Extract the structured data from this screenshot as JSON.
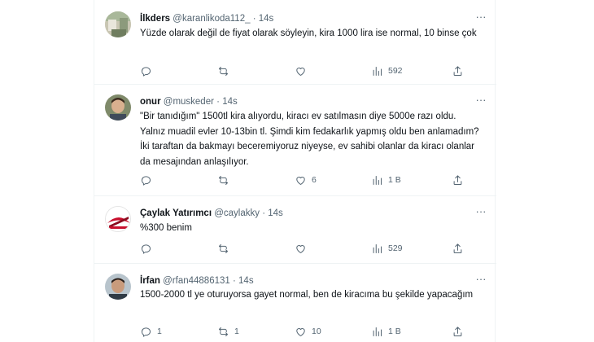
{
  "tweets": [
    {
      "name": "İlkders",
      "handle": "@karanlikoda112_",
      "dot": "·",
      "time": "14s",
      "text": "Yüzde olarak değil de fiyat olarak söyleyin, kira 1000 lira ise normal, 10 binse çok",
      "replies": "",
      "retweets": "",
      "likes": "",
      "views": "592",
      "avatar": "photo-ilkders"
    },
    {
      "name": "onur",
      "handle": "@muskeder",
      "dot": "·",
      "time": "14s",
      "text": "\"Bir tanıdığım\" 1500tl kira alıyordu, kiracı ev satılmasın diye 5000e razı oldu. Yalnız muadil evler 10-13bin tl. Şimdi kim fedakarlık yapmış oldu ben anlamadım? İki taraftan da bakmayı beceremiyoruz niyeyse, ev sahibi olanlar da kiracı olanlar da mesajından anlaşılıyor.",
      "replies": "",
      "retweets": "",
      "likes": "6",
      "views": "1 B",
      "avatar": "photo-onur"
    },
    {
      "name": "Çaylak Yatırımcı",
      "handle": "@caylakky",
      "dot": "·",
      "time": "14s",
      "text": "%300 benim",
      "replies": "",
      "retweets": "",
      "likes": "",
      "views": "529",
      "avatar": "logo-caylak"
    },
    {
      "name": "İrfan",
      "handle": "@rfan44886131",
      "dot": "·",
      "time": "14s",
      "text": "1500-2000 tl ye oturuyorsa gayet normal, ben de kiracıma bu şekilde yapacağım",
      "replies": "1",
      "retweets": "1",
      "likes": "10",
      "views": "1 B",
      "avatar": "photo-irfan"
    }
  ],
  "icons": {
    "reply": "reply-icon",
    "retweet": "retweet-icon",
    "like": "heart-icon",
    "views": "views-icon",
    "share": "share-icon",
    "more": "more-icon"
  },
  "colors": {
    "text": "#0f1419",
    "secondary": "#536471",
    "border": "#eff3f4",
    "background": "#ffffff"
  }
}
